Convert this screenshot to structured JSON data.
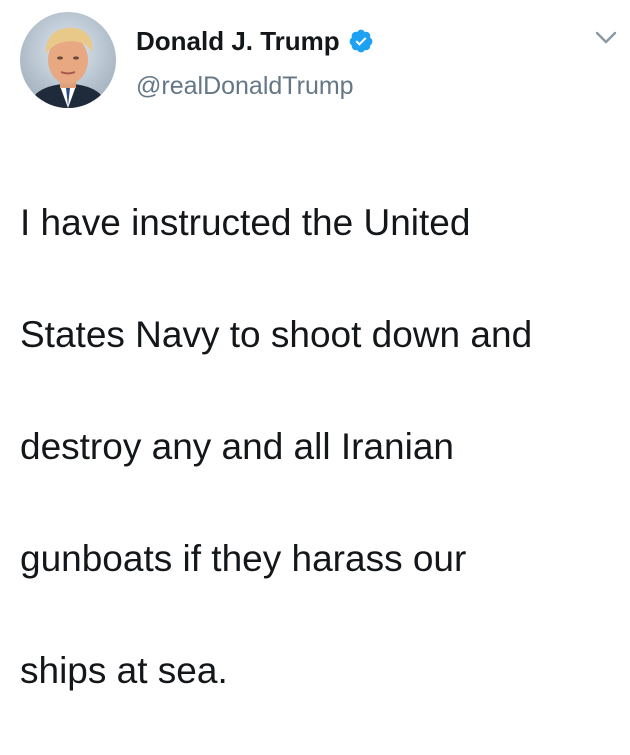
{
  "tweet": {
    "display_name": "Donald J. Trump",
    "handle": "@realDonaldTrump",
    "verified": true,
    "text_lines": [
      "I have instructed the United",
      "States Navy to shoot down and",
      "destroy any and all Iranian",
      "gunboats if they harass our",
      "ships at sea."
    ],
    "icons": {
      "avatar": "profile-photo",
      "verified": "verified-badge-icon",
      "menu": "chevron-down-icon"
    },
    "colors": {
      "verified_blue": "#1da1f2",
      "handle_gray": "#657786",
      "text": "#14171a"
    }
  }
}
